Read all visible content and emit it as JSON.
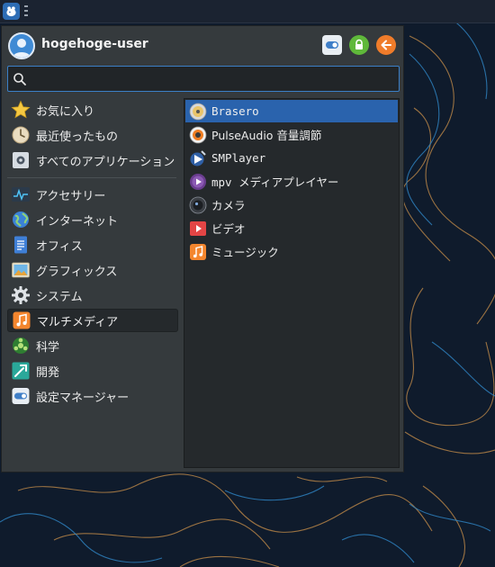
{
  "header": {
    "user_name": "hogehoge-user",
    "buttons": {
      "settings": "settings-toggle-icon",
      "lock": "lock-icon",
      "logout": "logout-arrow-icon"
    }
  },
  "search": {
    "value": "",
    "placeholder": ""
  },
  "categories": [
    {
      "label": "お気に入り",
      "icon": "star-icon"
    },
    {
      "label": "最近使ったもの",
      "icon": "recent-clock-icon"
    },
    {
      "label": "すべてのアプリケーション",
      "icon": "all-apps-icon"
    },
    {
      "label": "アクセサリー",
      "icon": "accessories-icon"
    },
    {
      "label": "インターネット",
      "icon": "internet-globe-icon"
    },
    {
      "label": "オフィス",
      "icon": "office-document-icon"
    },
    {
      "label": "グラフィックス",
      "icon": "graphics-image-icon"
    },
    {
      "label": "システム",
      "icon": "system-gear-icon"
    },
    {
      "label": "マルチメディア",
      "icon": "multimedia-music-icon"
    },
    {
      "label": "科学",
      "icon": "science-icon"
    },
    {
      "label": "開発",
      "icon": "development-icon"
    },
    {
      "label": "設定マネージャー",
      "icon": "settings-manager-icon"
    }
  ],
  "selected_category": "マルチメディア",
  "apps": [
    {
      "label": "Brasero",
      "icon": "brasero-disc-icon"
    },
    {
      "label": "PulseAudio 音量調節",
      "icon": "pulseaudio-speaker-icon"
    },
    {
      "label": "SMPlayer",
      "icon": "smplayer-icon"
    },
    {
      "label": "mpv メディアプレイヤー",
      "icon": "mpv-play-icon"
    },
    {
      "label": "カメラ",
      "icon": "camera-icon"
    },
    {
      "label": "ビデオ",
      "icon": "video-icon"
    },
    {
      "label": "ミュージック",
      "icon": "music-icon"
    }
  ],
  "selected_app": "Brasero",
  "colors": {
    "accent": "#2a63ad",
    "menu_bg": "#353a3d",
    "list_bg": "#25292c",
    "search_border": "#3b7fc6"
  }
}
